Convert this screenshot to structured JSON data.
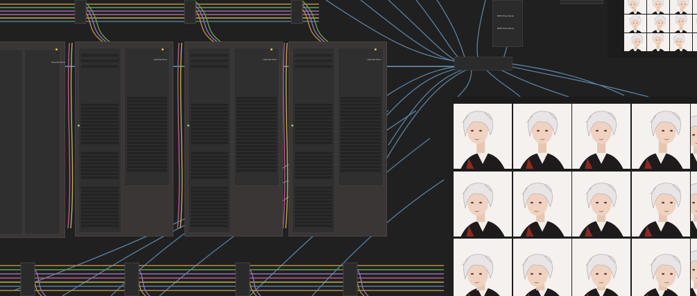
{
  "app": {
    "type": "node-graph-editor",
    "background": "#202020",
    "accent_colors": {
      "wire_blue": "#5d86a8",
      "wire_purple": "#a27ac8",
      "wire_orange": "#c79a4a",
      "wire_green": "#6fae5a",
      "wire_pink": "#c46a9a",
      "wire_yellow": "#d3c05a",
      "slot_yellow": "#e5c23f",
      "slot_green": "#7fd06b"
    }
  },
  "node_groups": [
    {
      "name": "Upscale Face",
      "label": "Upscale Face"
    },
    {
      "name": "Upscale Face",
      "label": "Upscale Face"
    },
    {
      "name": "Upscale Face",
      "label": "Upscale Face"
    },
    {
      "name": "Upscale Face",
      "label": "Upscale Face"
    }
  ],
  "collector_node": {
    "rows": [
      "NEW Pose Node",
      "NEW Pose Node"
    ]
  },
  "image_grid": {
    "rows": 3,
    "columns": 4,
    "subject": "white-haired young man, head-pose variations",
    "poses": [
      [
        "up-left",
        "up",
        "up-front",
        "up-right"
      ],
      [
        "left",
        "front-left",
        "front",
        "front-right"
      ],
      [
        "down-left",
        "down-front-left",
        "down",
        "down-right"
      ]
    ]
  },
  "preview_grid": {
    "rows": 3,
    "columns": 4
  }
}
